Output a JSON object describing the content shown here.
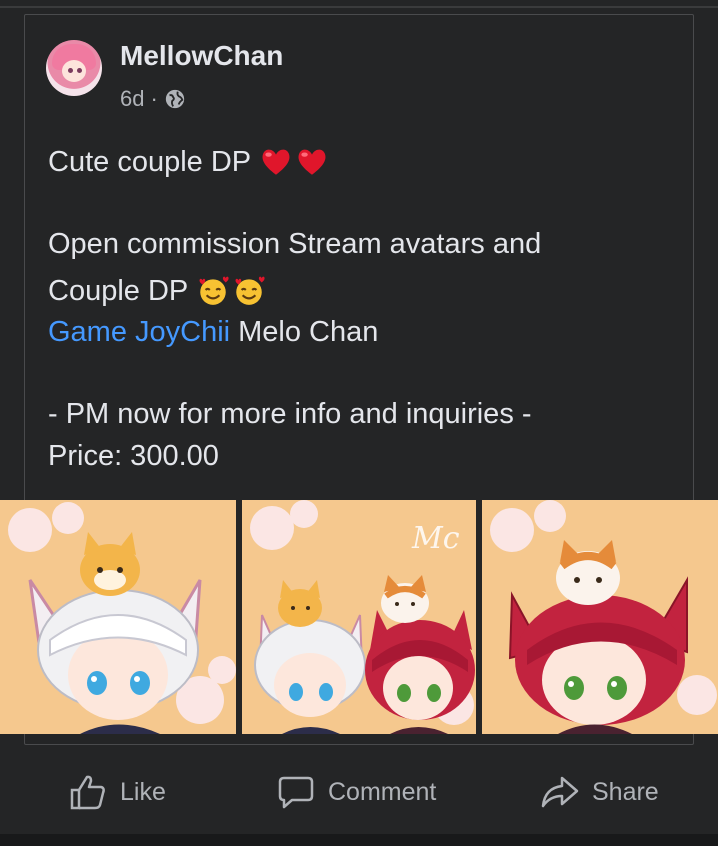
{
  "post": {
    "author": "MellowChan",
    "time": "6d",
    "separator": "·",
    "privacy_icon": "globe-icon",
    "line1": "Cute couple DP",
    "line2": "Open commission Stream avatars and",
    "line3": "Couple DP",
    "tag_link": "Game JoyChii",
    "tag_name": "Melo Chan",
    "line5": "- PM now for more info and inquiries -",
    "line6": "Price: 300.00",
    "photo_watermark": "Mc"
  },
  "actions": {
    "like_label": "Like",
    "comment_label": "Comment",
    "share_label": "Share"
  },
  "colors": {
    "background": "#242526",
    "text": "#e4e6eb",
    "secondary_text": "#b0b3b8",
    "link": "#4599ff",
    "heart": "#e0162b"
  }
}
